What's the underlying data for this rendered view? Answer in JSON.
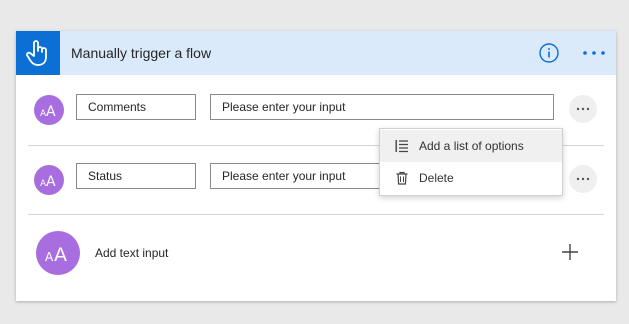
{
  "header": {
    "title": "Manually trigger a flow",
    "icons": {
      "trigger": "hand-pointer-icon",
      "info": "info-icon",
      "more": "ellipsis-icon"
    }
  },
  "rows": [
    {
      "name_value": "Comments",
      "description_value": "Please enter your input",
      "avatar_text": "AA"
    },
    {
      "name_value": "Status",
      "description_value": "Please enter your input",
      "avatar_text": "AA"
    }
  ],
  "add_input": {
    "label": "Add text input",
    "avatar_text": "AA"
  },
  "context_menu": {
    "items": [
      {
        "label": "Add a list of options",
        "icon": "list-icon"
      },
      {
        "label": "Delete",
        "icon": "trash-icon"
      }
    ]
  },
  "colors": {
    "accent": "#0b6fd6",
    "header_bg": "#dbeafb",
    "avatar": "#a86ee0"
  }
}
